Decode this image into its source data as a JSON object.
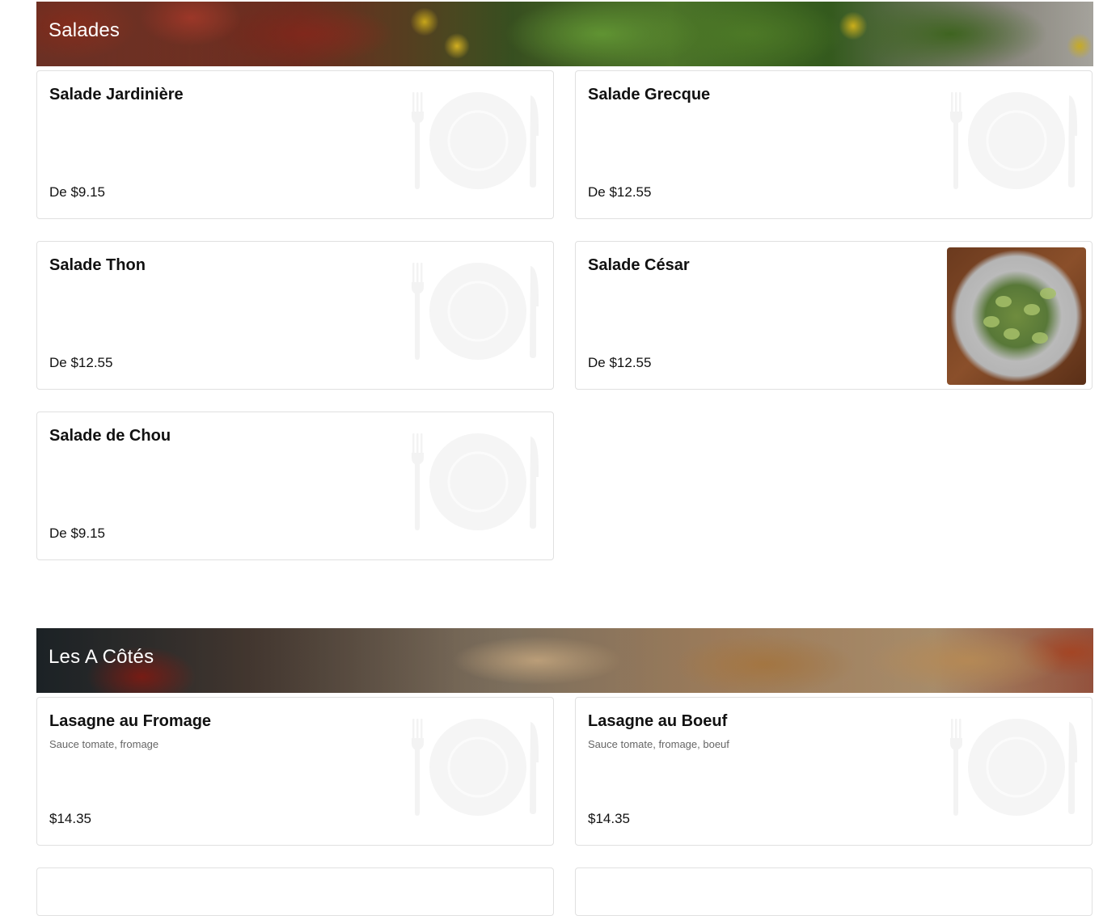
{
  "sections": [
    {
      "title": "Salades",
      "items": [
        {
          "name": "Salade Jardinière",
          "price": "De $9.15"
        },
        {
          "name": "Salade Grecque",
          "price": "De $12.55"
        },
        {
          "name": "Salade Thon",
          "price": "De $12.55"
        },
        {
          "name": "Salade César",
          "price": "De $12.55"
        },
        {
          "name": "Salade de Chou",
          "price": "De $9.15"
        }
      ]
    },
    {
      "title": "Les A Côtés",
      "items": [
        {
          "name": "Lasagne au Fromage",
          "description": "Sauce tomate, fromage",
          "price": "$14.35"
        },
        {
          "name": "Lasagne au Boeuf",
          "description": "Sauce tomate, fromage, boeuf",
          "price": "$14.35"
        }
      ]
    }
  ]
}
